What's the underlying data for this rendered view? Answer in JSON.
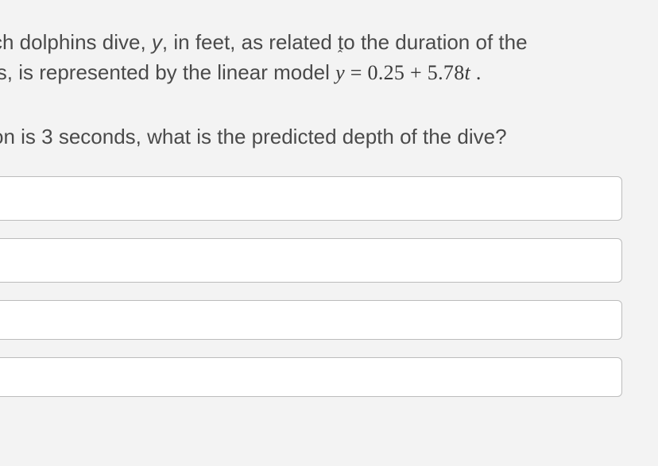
{
  "paragraph": {
    "line1_a": "ch dolphins dive, ",
    "line1_var": "y",
    "line1_b": ", in feet, as related to the duration of the",
    "line2_a": "ls, is represented by the linear model  ",
    "formula_y": "y",
    "formula_rest": " = 0.25 + 5.78",
    "formula_t": "t",
    "formula_period": " ."
  },
  "question": {
    "text": "on is 3 seconds, what is the predicted depth of the dive?"
  }
}
